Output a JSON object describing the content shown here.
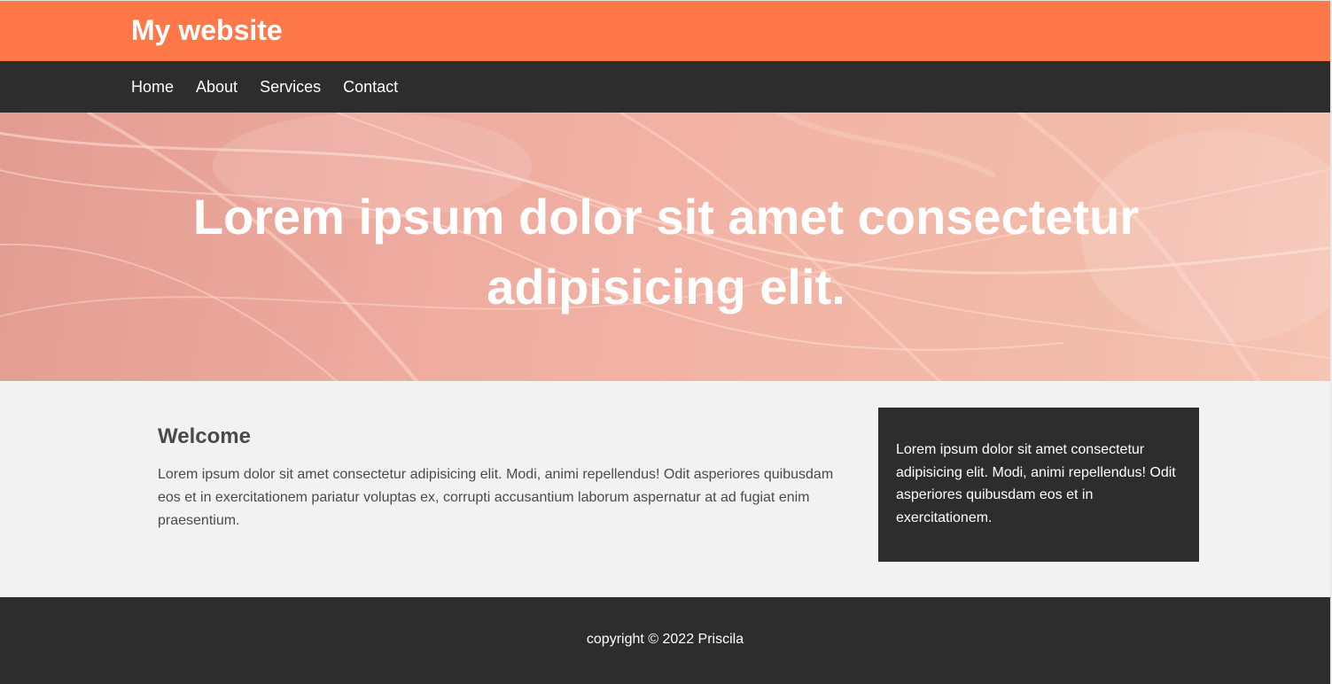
{
  "header": {
    "brand": "My website"
  },
  "nav": {
    "items": [
      "Home",
      "About",
      "Services",
      "Contact"
    ]
  },
  "hero": {
    "headline": "Lorem ipsum dolor sit amet consectetur adipisicing elit."
  },
  "main": {
    "title": "Welcome",
    "body": "Lorem ipsum dolor sit amet consectetur adipisicing elit. Modi, animi repellendus! Odit asperiores quibusdam eos et in exercitationem pariatur voluptas ex, corrupti accusantium laborum aspernatur at ad fugiat enim praesentium."
  },
  "sidebar": {
    "text": "Lorem ipsum dolor sit amet consectetur adipisicing elit. Modi, animi repellendus! Odit asperiores quibusdam eos et in exercitationem."
  },
  "footer": {
    "copyright": "copyright © 2022 Priscila"
  },
  "colors": {
    "header_bg": "#ff7849",
    "dark_bg": "#2d2d2d",
    "page_bg": "#f2f2f2"
  }
}
